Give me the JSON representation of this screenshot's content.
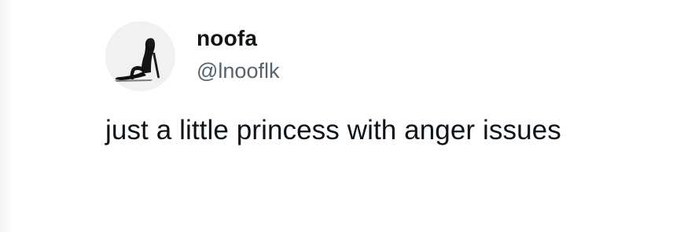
{
  "tweet": {
    "author": {
      "display_name": "noofa",
      "handle": "@lnooflk",
      "avatar_icon": "profile-photo-silhouette"
    },
    "text": "just a little princess with anger issues"
  },
  "colors": {
    "background": "#ffffff",
    "primary_text": "#0f1419",
    "secondary_text": "#536471",
    "avatar_background": "#f1f1f1"
  }
}
